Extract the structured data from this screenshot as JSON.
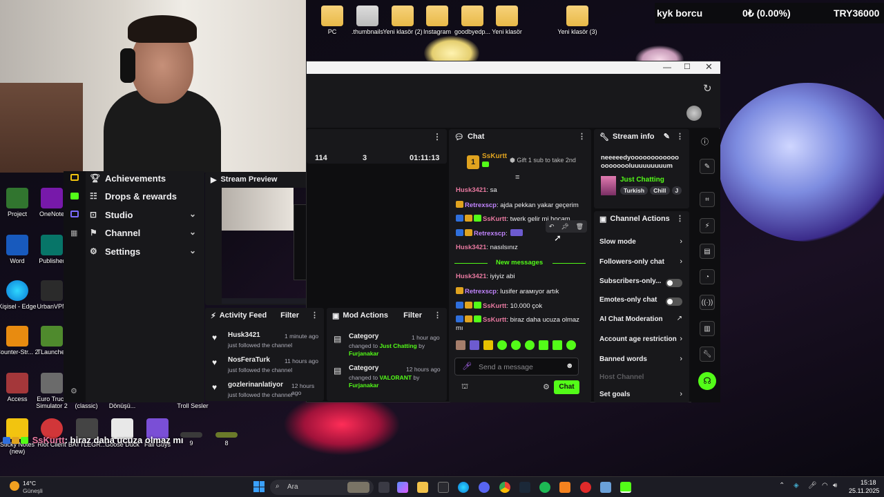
{
  "desktop": {
    "top_icons": [
      "PC",
      ".thumbnails",
      "Yeni klasör (2)",
      "Instagram",
      "goodbyedp...",
      "Yeni klasör",
      "Yeni klasör (3)"
    ],
    "left_icons": [
      "Project",
      "OneNote",
      "Word",
      "Publisher",
      "Kişisel - Edge",
      "UrbanVPN",
      "Counter-Str... 2",
      "TLauncher",
      "Access",
      "Euro Truck Simulator 2"
    ],
    "bottom_labels": [
      "(classic)",
      "Dönüşü...",
      "Troll Sesler",
      "Sticky Notes (new)",
      "Riot Client",
      "BATTLEGR...",
      "Goose Duck",
      "Fall Guys"
    ],
    "bottom_right_labels": [
      "9",
      "8"
    ]
  },
  "overlay": {
    "kyk_label": "kyk borcu",
    "percent": "0₺ (0.00%)",
    "total": "TRY36000",
    "chat_user": "SsKurtt",
    "chat_msg": ": biraz daha ucuza olmaz mı"
  },
  "nav": {
    "items": [
      {
        "label": "Achievements",
        "icon": "trophy-icon"
      },
      {
        "label": "Drops & rewards",
        "icon": "drops-icon"
      },
      {
        "label": "Studio",
        "icon": "studio-icon"
      },
      {
        "label": "Channel",
        "icon": "channel-icon"
      },
      {
        "label": "Settings",
        "icon": "gear-icon"
      }
    ]
  },
  "stream_preview": {
    "title": "Stream Preview"
  },
  "stats": {
    "viewers": "114",
    "followers": "3",
    "uptime": "01:11:13"
  },
  "chat": {
    "title": "Chat",
    "gift_user": "SsKurtt",
    "gift_count": "1",
    "gift_text": "Gift 1 sub to take 2nd",
    "new_messages": "New messages",
    "input_placeholder": "Send a message",
    "send_label": "Chat",
    "messages": [
      {
        "user": "Husk3421",
        "text": ": sa"
      },
      {
        "user": "Retrexscp",
        "text": ": ajda pekkan yakar geçerim"
      },
      {
        "user": "SsKurtt",
        "text": ": twerk gelir mi hocam"
      },
      {
        "user": "Retrexscp",
        "text": ":"
      },
      {
        "user": "Husk3421",
        "text": ": nasılsınız"
      },
      {
        "user": "Husk3421",
        "text": ": iyiyiz abi"
      },
      {
        "user": "Retrexscp",
        "text": ": lusifer arамıyor artık"
      },
      {
        "user": "SsKurtt",
        "text": ": 10.000 çok"
      },
      {
        "user": "SsKurtt",
        "text": ": biraz daha ucuza olmaz"
      },
      {
        "user": "",
        "text": "mı"
      }
    ]
  },
  "stream_info": {
    "title": "Stream info",
    "stream_title": "neeeeedyoooooooooooooooooooluuuuuuuuum",
    "category": "Just Chatting",
    "tags": [
      "Turkish",
      "Chill",
      "J"
    ]
  },
  "channel_actions": {
    "title": "Channel Actions",
    "items": [
      {
        "label": "Slow mode",
        "kind": "arrow"
      },
      {
        "label": "Followers-only chat",
        "kind": "arrow"
      },
      {
        "label": "Subscribers-only...",
        "kind": "toggle"
      },
      {
        "label": "Emotes-only chat",
        "kind": "toggle"
      },
      {
        "label": "AI Chat Moderation",
        "kind": "external"
      },
      {
        "label": "Account age restriction",
        "kind": "arrow"
      },
      {
        "label": "Banned words",
        "kind": "arrow"
      },
      {
        "label": "Host Channel",
        "kind": "disabled"
      },
      {
        "label": "Set goals",
        "kind": "arrow"
      }
    ]
  },
  "activity": {
    "title": "Activity Feed",
    "filter": "Filter",
    "items": [
      {
        "user": "Husk3421",
        "time": "1 minute ago",
        "desc": "just followed the channel"
      },
      {
        "user": "NosFeraTurk",
        "time": "11 hours ago",
        "desc": "just followed the channel"
      },
      {
        "user": "gozlerinanlatiyor",
        "time": "12 hours ago",
        "desc": "just followed the channel"
      }
    ]
  },
  "mod_actions": {
    "title": "Mod Actions",
    "filter": "Filter",
    "items": [
      {
        "title": "Category",
        "time": "1 hour ago",
        "pre": "changed to ",
        "value": "Just Chatting",
        "by": " by",
        "user": "Furjanakar"
      },
      {
        "title": "Category",
        "time": "12 hours ago",
        "pre": "changed to ",
        "value": "VALORANT",
        "by": " by",
        "user": "Furjanakar"
      }
    ]
  },
  "taskbar": {
    "weather_temp": "14°C",
    "weather_place": "Güneşli",
    "search": "Ara",
    "time": "15:18",
    "date": "25.11.2025"
  },
  "colors": {
    "accent": "#53fc18",
    "bg": "#0e0e10",
    "panel": "#1f1f23"
  }
}
